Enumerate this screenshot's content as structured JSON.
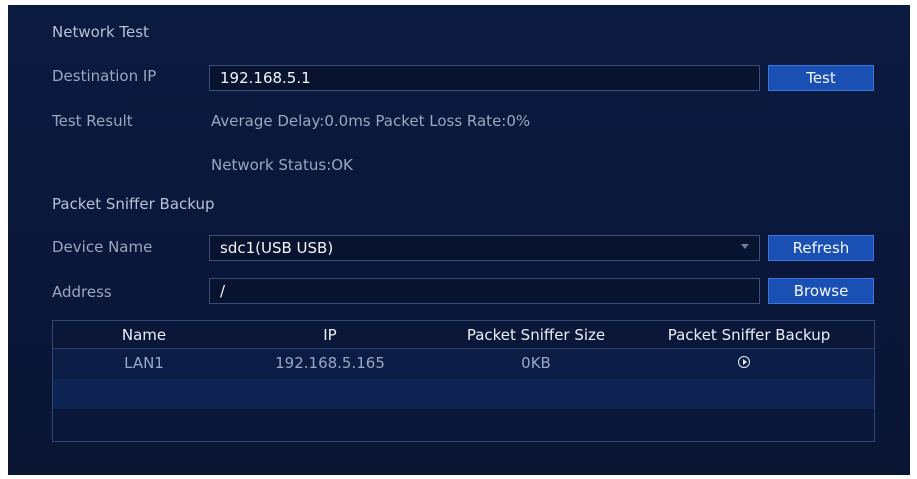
{
  "network_test": {
    "section_title": "Network Test",
    "destination_label": "Destination IP",
    "destination_value": "192.168.5.1",
    "test_button": "Test",
    "result_label": "Test Result",
    "result_line1": "Average Delay:0.0ms  Packet Loss Rate:0%",
    "result_line2": "Network Status:OK"
  },
  "sniffer": {
    "section_title": "Packet Sniffer Backup",
    "device_label": "Device Name",
    "device_value": "sdc1(USB USB)",
    "refresh_button": "Refresh",
    "address_label": "Address",
    "address_value": "/",
    "browse_button": "Browse"
  },
  "table": {
    "columns": [
      "Name",
      "IP",
      "Packet Sniffer Size",
      "Packet Sniffer Backup"
    ],
    "rows": [
      {
        "name": "LAN1",
        "ip": "192.168.5.165",
        "size": "0KB",
        "backup_icon": "play-circle-icon"
      }
    ]
  }
}
